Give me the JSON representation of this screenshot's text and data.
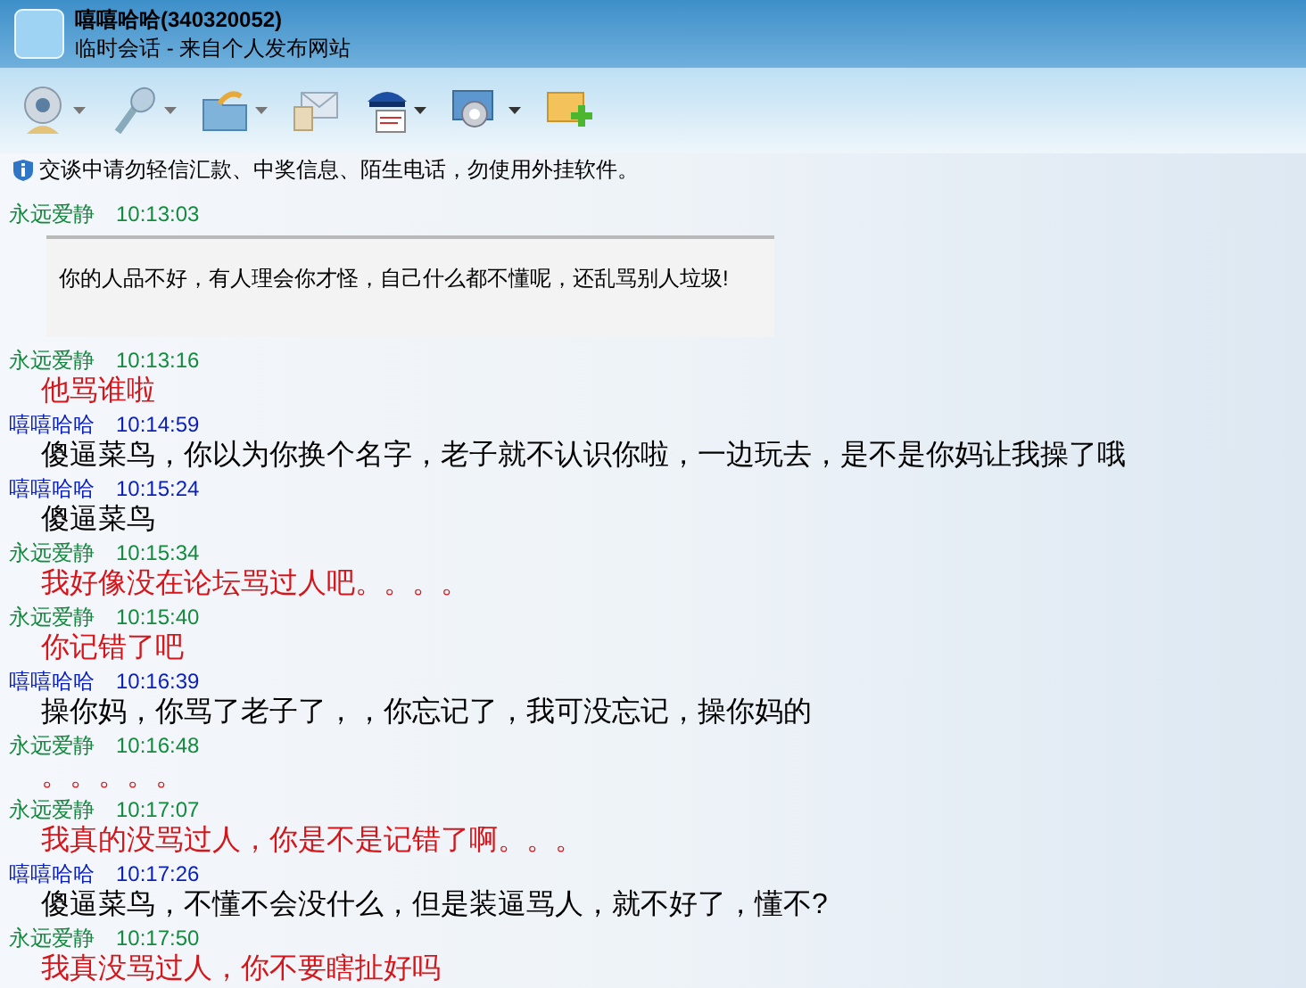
{
  "window": {
    "title": "嘻嘻哈哈(340320052)",
    "subtitle": "临时会话 - 来自个人发布网站"
  },
  "notice": "交谈中请勿轻信汇款、中奖信息、陌生电话，勿使用外挂软件。",
  "messages": [
    {
      "sender": "永远爱静",
      "color": "#138a3e",
      "time": "10:13:03",
      "kind": "quote",
      "text": "你的人品不好，有人理会你才怪，自己什么都不懂呢，还乱骂别人垃圾!"
    },
    {
      "sender": "永远爱静",
      "color": "#138a3e",
      "time": "10:13:16",
      "kind": "plain",
      "text": "他骂谁啦"
    },
    {
      "sender": "嘻嘻哈哈",
      "color": "#0a1fb8",
      "time": "10:14:59",
      "kind": "plain",
      "text": "傻逼菜鸟，你以为你换个名字，老子就不认识你啦，一边玩去，是不是你妈让我操了哦"
    },
    {
      "sender": "嘻嘻哈哈",
      "color": "#0a1fb8",
      "time": "10:15:24",
      "kind": "plain",
      "text": "傻逼菜鸟"
    },
    {
      "sender": "永远爱静",
      "color": "#138a3e",
      "time": "10:15:34",
      "kind": "plain",
      "text": "我好像没在论坛骂过人吧。。。。"
    },
    {
      "sender": "永远爱静",
      "color": "#138a3e",
      "time": "10:15:40",
      "kind": "plain",
      "text": "你记错了吧"
    },
    {
      "sender": "嘻嘻哈哈",
      "color": "#0a1fb8",
      "time": "10:16:39",
      "kind": "plain",
      "text": "操你妈，你骂了老子了，，你忘记了，我可没忘记，操你妈的"
    },
    {
      "sender": "永远爱静",
      "color": "#138a3e",
      "time": "10:16:48",
      "kind": "plain",
      "text": "。。。。。"
    },
    {
      "sender": "永远爱静",
      "color": "#138a3e",
      "time": "10:17:07",
      "kind": "plain",
      "text": "我真的没骂过人，你是不是记错了啊。。。"
    },
    {
      "sender": "嘻嘻哈哈",
      "color": "#0a1fb8",
      "time": "10:17:26",
      "kind": "plain",
      "text": "傻逼菜鸟，不懂不会没什么，但是装逼骂人，就不好了，懂不?"
    },
    {
      "sender": "永远爱静",
      "color": "#138a3e",
      "time": "10:17:50",
      "kind": "plain",
      "text": "我真没骂过人，你不要瞎扯好吗"
    }
  ]
}
